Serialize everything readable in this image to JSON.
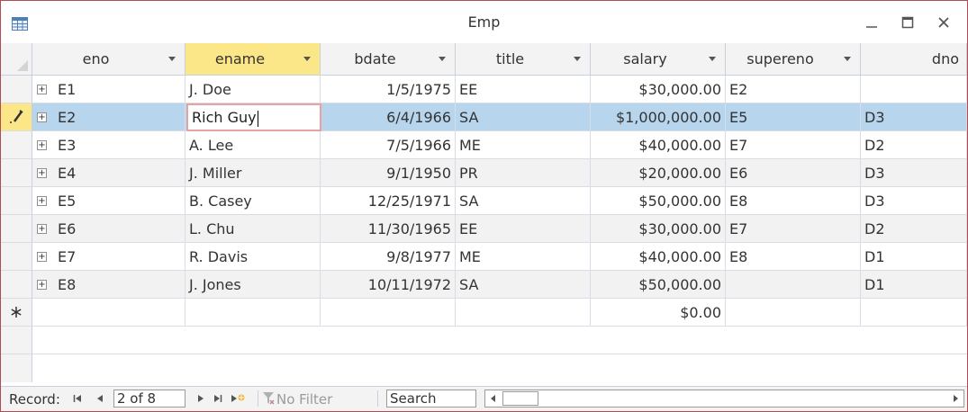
{
  "window": {
    "title": "Emp"
  },
  "columns": [
    {
      "key": "eno",
      "label": "eno"
    },
    {
      "key": "ename",
      "label": "ename"
    },
    {
      "key": "bdate",
      "label": "bdate"
    },
    {
      "key": "title",
      "label": "title"
    },
    {
      "key": "salary",
      "label": "salary"
    },
    {
      "key": "supereno",
      "label": "supereno"
    },
    {
      "key": "dno",
      "label": "dno"
    }
  ],
  "rows": [
    {
      "eno": "E1",
      "ename": "J. Doe",
      "bdate": "1/5/1975",
      "title": "EE",
      "salary": "$30,000.00",
      "supereno": "E2",
      "dno": ""
    },
    {
      "eno": "E2",
      "ename": "Rich Guy",
      "bdate": "6/4/1966",
      "title": "SA",
      "salary": "$1,000,000.00",
      "supereno": "E5",
      "dno": "D3"
    },
    {
      "eno": "E3",
      "ename": "A. Lee",
      "bdate": "7/5/1966",
      "title": "ME",
      "salary": "$40,000.00",
      "supereno": "E7",
      "dno": "D2"
    },
    {
      "eno": "E4",
      "ename": "J. Miller",
      "bdate": "9/1/1950",
      "title": "PR",
      "salary": "$20,000.00",
      "supereno": "E6",
      "dno": "D3"
    },
    {
      "eno": "E5",
      "ename": "B. Casey",
      "bdate": "12/25/1971",
      "title": "SA",
      "salary": "$50,000.00",
      "supereno": "E8",
      "dno": "D3"
    },
    {
      "eno": "E6",
      "ename": "L. Chu",
      "bdate": "11/30/1965",
      "title": "EE",
      "salary": "$30,000.00",
      "supereno": "E7",
      "dno": "D2"
    },
    {
      "eno": "E7",
      "ename": "R. Davis",
      "bdate": "9/8/1977",
      "title": "ME",
      "salary": "$40,000.00",
      "supereno": "E8",
      "dno": "D1"
    },
    {
      "eno": "E8",
      "ename": "J. Jones",
      "bdate": "10/11/1972",
      "title": "SA",
      "salary": "$50,000.00",
      "supereno": "",
      "dno": "D1"
    }
  ],
  "new_row": {
    "salary": "$0.00"
  },
  "selected_row_index": 1,
  "sorted_column": "ename",
  "navbar": {
    "record_label": "Record:",
    "record_value": "2 of 8",
    "no_filter_label": "No Filter",
    "search_placeholder": "Search"
  },
  "colors": {
    "selected_row": "#b7d6ee",
    "sorted_header": "#fce788",
    "border": "#b24b52",
    "edit_outline": "#e9a2a2"
  },
  "icons": {
    "app": "table-icon",
    "edit": "pencil-icon",
    "new_row": "asterisk-icon",
    "expand": "plus-box-icon"
  }
}
